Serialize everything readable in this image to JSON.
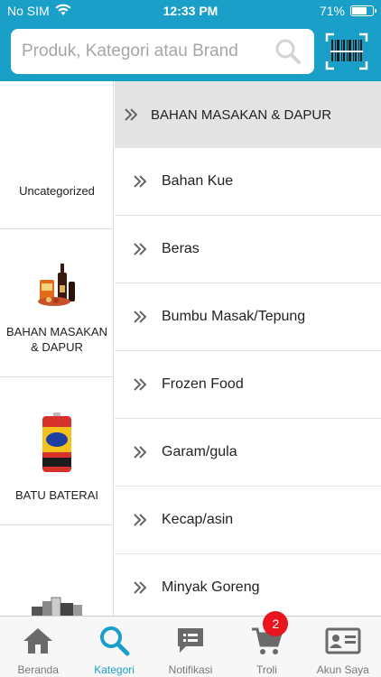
{
  "status_bar": {
    "carrier": "No SIM",
    "time": "12:33 PM",
    "battery": "71%",
    "battery_level": 0.71
  },
  "search": {
    "placeholder": "Produk, Kategori atau Brand"
  },
  "sidebar": {
    "items": [
      {
        "label": "Uncategorized"
      },
      {
        "label": "BAHAN MASAKAN & DAPUR"
      },
      {
        "label": "BATU BATERAI"
      },
      {
        "label": ""
      }
    ]
  },
  "category": {
    "title": "BAHAN MASAKAN & DAPUR",
    "subcategories": [
      "Bahan Kue",
      "Beras",
      "Bumbu Masak/Tepung",
      "Frozen Food",
      "Garam/gula",
      "Kecap/asin",
      "Minyak Goreng"
    ]
  },
  "tabs": [
    {
      "label": "Beranda",
      "icon": "home-icon"
    },
    {
      "label": "Kategori",
      "icon": "search-icon"
    },
    {
      "label": "Notifikasi",
      "icon": "chat-icon"
    },
    {
      "label": "Troli",
      "icon": "cart-icon",
      "badge": "2"
    },
    {
      "label": "Akun Saya",
      "icon": "id-card-icon"
    }
  ],
  "colors": {
    "brand": "#1aa0c8",
    "badge": "#e8141e",
    "selected_bg": "#e4e4e4"
  }
}
